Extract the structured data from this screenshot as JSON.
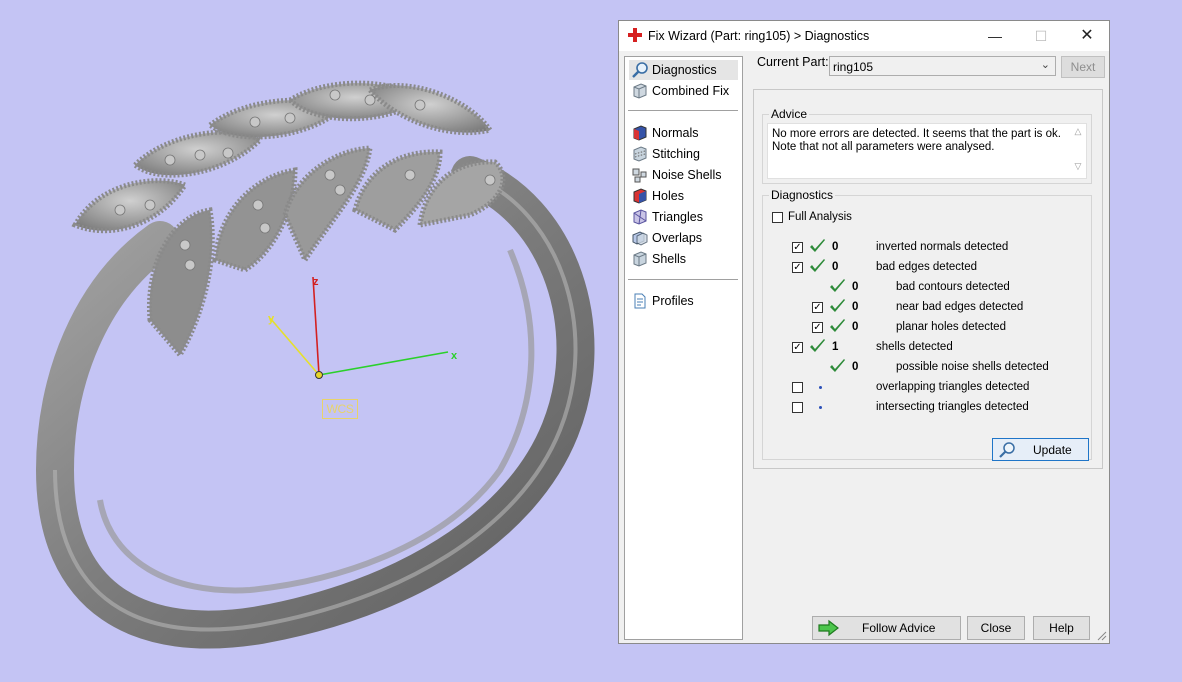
{
  "viewport": {
    "background": "#c4c4f4",
    "axes": {
      "x": "x",
      "y": "y",
      "z": "z"
    },
    "wcs_label": "WCS"
  },
  "dialog": {
    "title": "Fix Wizard (Part: ring105) > Diagnostics",
    "window_buttons": {
      "minimize": "—",
      "maximize": "☐",
      "close": "✕"
    },
    "nav": {
      "groups": [
        [
          {
            "label": "Diagnostics",
            "icon": "magnifier-icon",
            "selected": true
          },
          {
            "label": "Combined Fix",
            "icon": "cube-icon"
          }
        ],
        [
          {
            "label": "Normals",
            "icon": "normals-icon"
          },
          {
            "label": "Stitching",
            "icon": "stitching-icon"
          },
          {
            "label": "Noise Shells",
            "icon": "noise-shells-icon"
          },
          {
            "label": "Holes",
            "icon": "holes-icon"
          },
          {
            "label": "Triangles",
            "icon": "triangles-icon"
          },
          {
            "label": "Overlaps",
            "icon": "overlaps-icon"
          },
          {
            "label": "Shells",
            "icon": "shells-icon"
          }
        ],
        [
          {
            "label": "Profiles",
            "icon": "document-icon"
          }
        ]
      ]
    },
    "current_part": {
      "label": "Current Part:",
      "value": "ring105"
    },
    "next_button": "Next",
    "advice": {
      "title": "Advice",
      "text_line1": "No more errors are detected. It seems that the part is ok.",
      "text_line2": "Note that not all parameters were analysed."
    },
    "diagnostics": {
      "title": "Diagnostics",
      "full_analysis": {
        "label": "Full Analysis",
        "checked": false
      },
      "rows": [
        {
          "checkbox": true,
          "tick": true,
          "count": "0",
          "label": "inverted normals detected",
          "indent": 0
        },
        {
          "checkbox": true,
          "tick": true,
          "count": "0",
          "label": "bad edges detected",
          "indent": 0
        },
        {
          "checkbox": null,
          "tick": true,
          "count": "0",
          "label": "bad contours detected",
          "indent": 1
        },
        {
          "checkbox": true,
          "tick": true,
          "count": "0",
          "label": "near bad edges detected",
          "indent": 1
        },
        {
          "checkbox": true,
          "tick": true,
          "count": "0",
          "label": "planar holes detected",
          "indent": 1
        },
        {
          "checkbox": true,
          "tick": true,
          "count": "1",
          "label": "shells detected",
          "indent": 0
        },
        {
          "checkbox": null,
          "tick": true,
          "count": "0",
          "label": "possible noise shells detected",
          "indent": 1
        },
        {
          "checkbox": false,
          "tick": false,
          "count": "",
          "label": "overlapping triangles detected",
          "indent": 0
        },
        {
          "checkbox": false,
          "tick": false,
          "count": "",
          "label": "intersecting triangles detected",
          "indent": 0
        }
      ],
      "update_button": "Update"
    },
    "buttons": {
      "follow_advice": "Follow Advice",
      "close": "Close",
      "help": "Help"
    },
    "colors": {
      "tick": "#2e8b3a",
      "accent": "#1f75c8",
      "follow_arrow": "#3cb043"
    }
  }
}
